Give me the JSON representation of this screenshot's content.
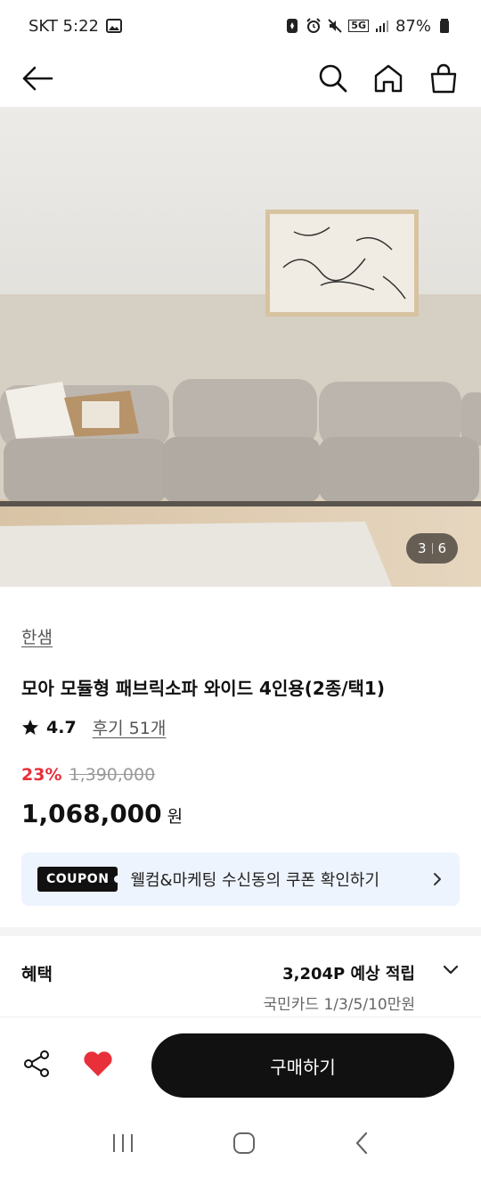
{
  "status_bar": {
    "carrier_time": "SKT 5:22",
    "battery": "87%",
    "network": "5G"
  },
  "app_bar": {
    "back_icon": "arrow-left-icon",
    "search_icon": "search-icon",
    "home_icon": "home-icon",
    "cart_icon": "shopping-bag-icon"
  },
  "hero": {
    "pager_current": "3",
    "pager_total": "6"
  },
  "product": {
    "brand": "한샘",
    "title": "모아 모듈형 패브릭소파 와이드 4인용(2종/택1)",
    "rating": "4.7",
    "review_link": "후기 51개",
    "discount": "23%",
    "original_price": "1,390,000",
    "price": "1,068,000",
    "currency": "원"
  },
  "coupon": {
    "tag": "COUPON",
    "text": "웰컴&마케팅 수신동의 쿠폰 확인하기"
  },
  "benefit": {
    "label": "혜택",
    "points": "3,204P 예상 적립",
    "card": "국민카드 1/3/5/10만원"
  },
  "action_bar": {
    "buy_label": "구매하기"
  },
  "colors": {
    "accent_red": "#e8303a",
    "coupon_bg": "#eef4fd",
    "buy_button": "#111111",
    "heart": "#e8303a"
  }
}
